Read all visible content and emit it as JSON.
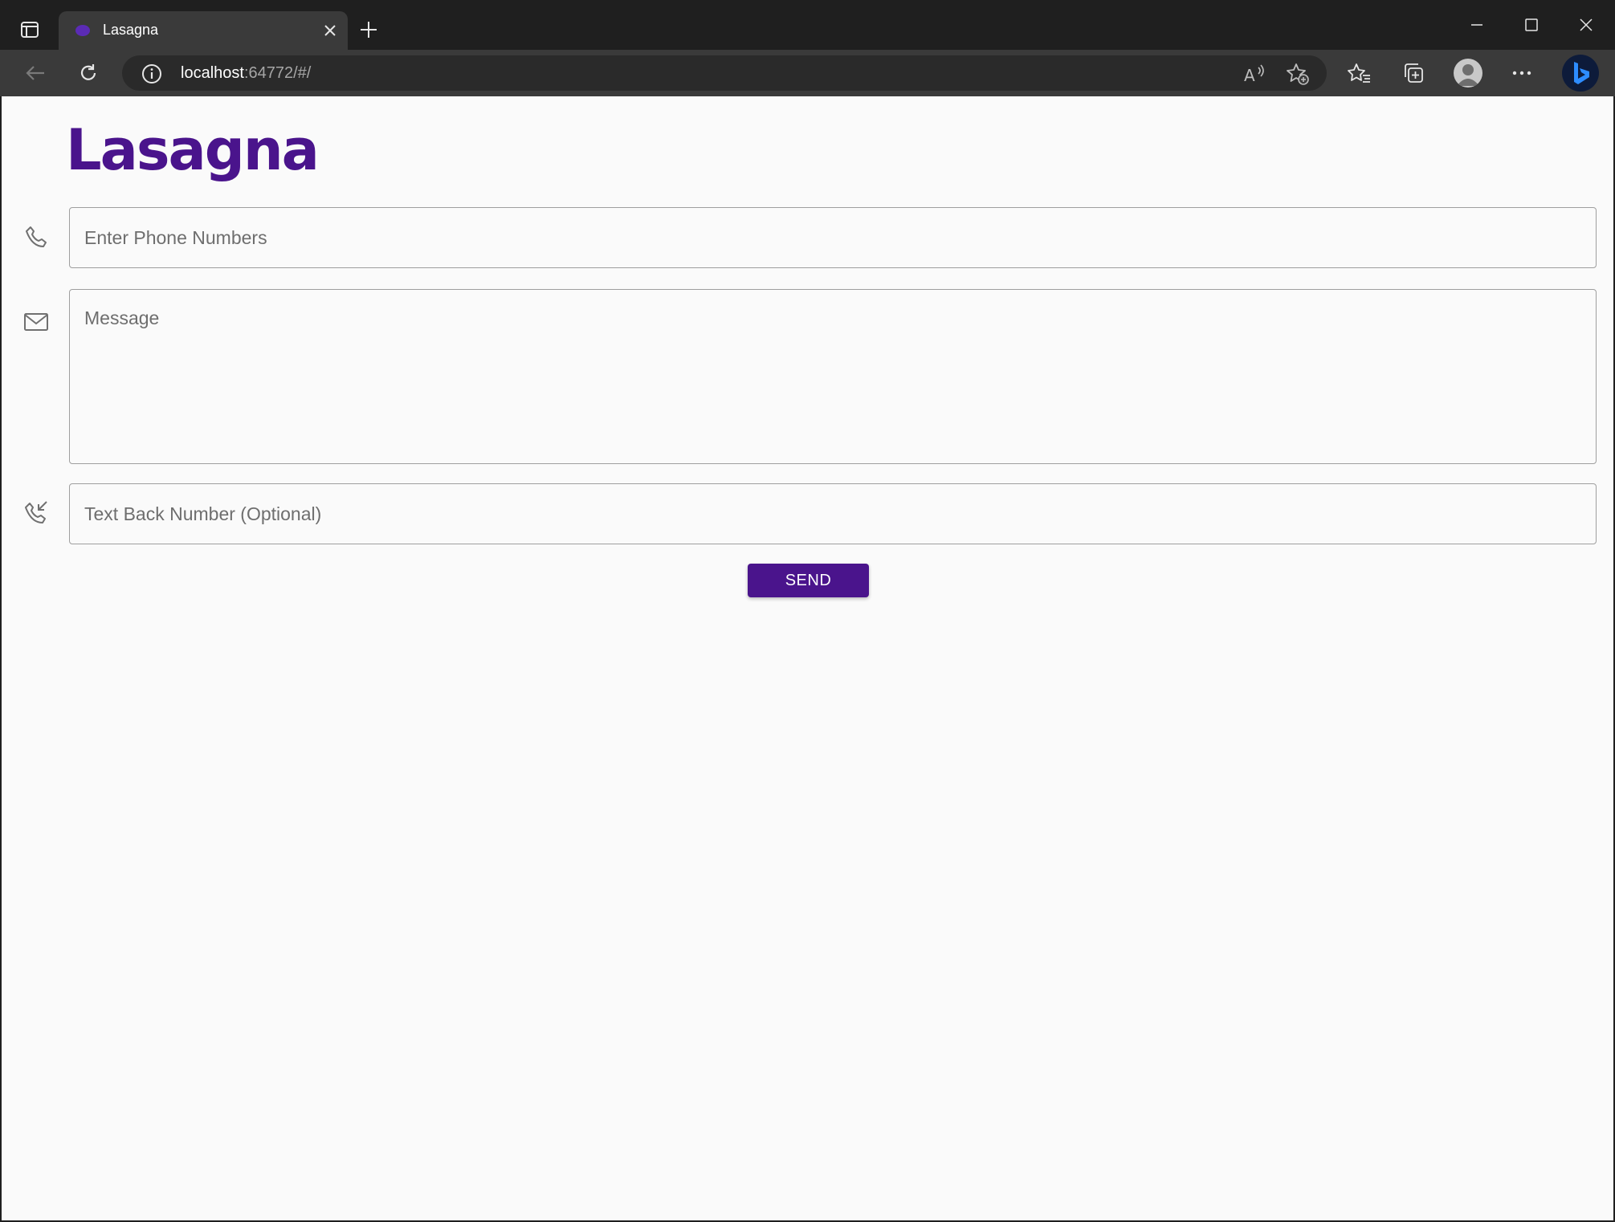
{
  "browser": {
    "tab_title": "Lasagna",
    "url_host": "localhost",
    "url_rest": ":64772/#/"
  },
  "app": {
    "logo_text": "Lasagna",
    "brand_color": "#4a148c",
    "phone_field": {
      "placeholder": "Enter Phone Numbers",
      "value": "",
      "icon": "phone-icon"
    },
    "message_field": {
      "placeholder": "Message",
      "value": "",
      "icon": "mail-icon"
    },
    "textback_field": {
      "placeholder": "Text Back Number (Optional)",
      "value": "",
      "icon": "phone-incoming-icon"
    },
    "send_label": "SEND"
  }
}
